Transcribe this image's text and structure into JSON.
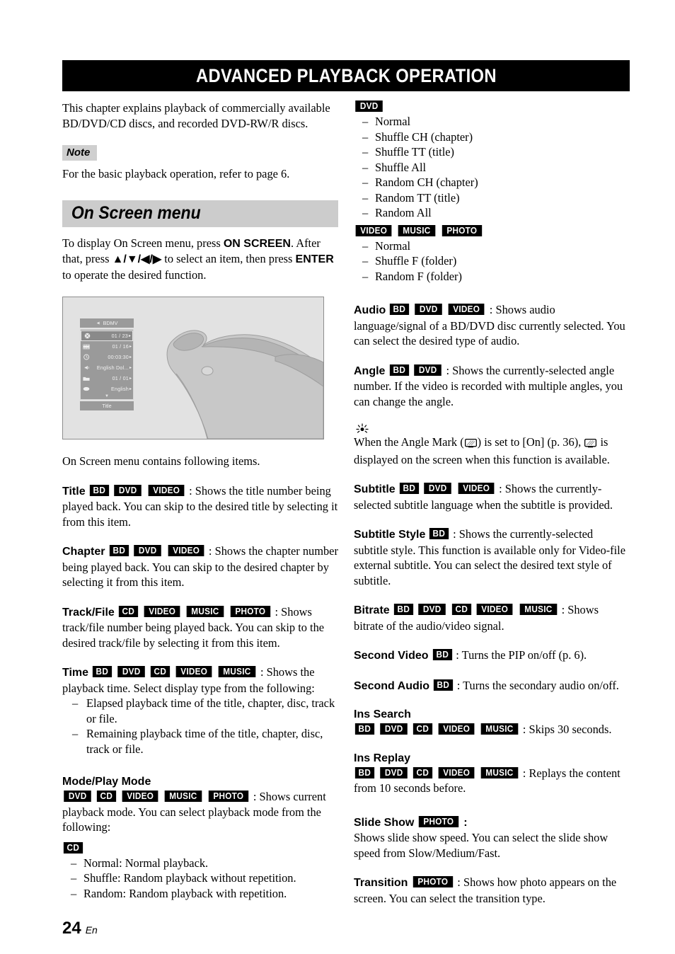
{
  "header": {
    "title": "ADVANCED PLAYBACK OPERATION"
  },
  "left_column": {
    "intro": "This chapter explains playback of commercially available BD/DVD/CD discs, and recorded DVD-RW/R discs.",
    "note_label": "Note",
    "note_text": "For the basic playback operation, refer to page 6.",
    "section_title": "On Screen menu",
    "section_intro_1": "To display On Screen menu, press ",
    "section_intro_key_1": "ON SCREEN",
    "section_intro_2": ". After that, press ",
    "section_intro_arrows": "▲/▼/◀/▶",
    "section_intro_3": " to select an item, then press ",
    "section_intro_key_2": "ENTER",
    "section_intro_4": " to operate the desired function.",
    "mockup": {
      "header_label": "BDMV",
      "footer_label": "Title",
      "rows": [
        {
          "icon": "disc-icon",
          "value": "01 / 23",
          "selected": true
        },
        {
          "icon": "filmstrip-icon",
          "value": "01 / 16",
          "selected": false
        },
        {
          "icon": "clock-icon",
          "value": "00:03:30",
          "selected": false
        },
        {
          "icon": "speaker-icon",
          "value": "English Dol...",
          "selected": false
        },
        {
          "icon": "folder-icon",
          "value": "01 / 01",
          "selected": false
        },
        {
          "icon": "subtitle-icon",
          "value": "English",
          "selected": false
        }
      ]
    },
    "contains_line": "On Screen menu contains following items.",
    "items": [
      {
        "term": "Title",
        "badges": [
          "BD",
          "DVD",
          "VIDEO"
        ],
        "body": ": Shows the title number being played back. You can skip to the desired title by selecting it from this item."
      },
      {
        "term": "Chapter",
        "badges": [
          "BD",
          "DVD",
          "VIDEO"
        ],
        "body": ": Shows the chapter number being played back. You can skip to the desired chapter by selecting it from this item."
      },
      {
        "term": "Track/File",
        "badges": [
          "CD",
          "VIDEO",
          "MUSIC",
          "PHOTO"
        ],
        "body": ": Shows track/file number being played back. You can skip to the desired track/file by selecting it from this item."
      },
      {
        "term": "Time",
        "badges": [
          "BD",
          "DVD",
          "CD",
          "VIDEO",
          "MUSIC"
        ],
        "body": ": Shows the playback time. Select display type from the following:",
        "list": [
          "Elapsed playback time of the title, chapter, disc, track or file.",
          "Remaining playback time of the title, chapter, disc, track or file."
        ]
      }
    ],
    "mode_item": {
      "term": "Mode/Play Mode",
      "badges": [
        "DVD",
        "CD",
        "VIDEO",
        "MUSIC",
        "PHOTO"
      ],
      "body": ": Shows current playback mode. You can select playback mode from the following:",
      "cd_badge": "CD",
      "cd_list": [
        "Normal: Normal playback.",
        "Shuffle: Random playback without repetition.",
        "Random: Random playback with repetition."
      ]
    }
  },
  "right_column": {
    "dvd_badge": "DVD",
    "dvd_list": [
      "Normal",
      "Shuffle CH (chapter)",
      "Shuffle TT (title)",
      "Shuffle All",
      "Random CH (chapter)",
      "Random TT (title)",
      "Random All"
    ],
    "vmp_badges": [
      "VIDEO",
      "MUSIC",
      "PHOTO"
    ],
    "vmp_list": [
      "Normal",
      "Shuffle F (folder)",
      "Random F (folder)"
    ],
    "items": [
      {
        "term": "Audio",
        "badges": [
          "BD",
          "DVD",
          "VIDEO"
        ],
        "body": ": Shows audio language/signal of a BD/DVD disc currently selected. You can select the desired type of audio."
      },
      {
        "term": "Angle",
        "badges": [
          "BD",
          "DVD"
        ],
        "body": ": Shows the currently-selected angle number. If the video is recorded with multiple angles, you can change the angle."
      }
    ],
    "tip": {
      "text_1": "When the Angle Mark (",
      "text_2": ") is set to [On] (p. 36), ",
      "text_3": " is displayed on the screen when this function is available."
    },
    "items2": [
      {
        "term": "Subtitle",
        "badges": [
          "BD",
          "DVD",
          "VIDEO"
        ],
        "body": ": Shows the currently-selected subtitle language when the subtitle is provided."
      },
      {
        "term": "Subtitle Style",
        "badges": [
          "BD"
        ],
        "body": ": Shows the currently-selected subtitle style. This function is available only for Video-file external subtitle. You can select the desired text style of subtitle."
      },
      {
        "term": "Bitrate",
        "badges": [
          "BD",
          "DVD",
          "CD",
          "VIDEO",
          "MUSIC"
        ],
        "body": ": Shows bitrate of the audio/video signal."
      },
      {
        "term": "Second Video",
        "badges": [
          "BD"
        ],
        "body": ": Turns the PIP on/off (p. 6)."
      },
      {
        "term": "Second Audio",
        "badges": [
          "BD"
        ],
        "body": ": Turns the secondary audio on/off."
      }
    ],
    "ins_search": {
      "term": "Ins Search",
      "badges": [
        "BD",
        "DVD",
        "CD",
        "VIDEO",
        "MUSIC"
      ],
      "body": ": Skips 30 seconds."
    },
    "ins_replay": {
      "term": "Ins Replay",
      "badges": [
        "BD",
        "DVD",
        "CD",
        "VIDEO",
        "MUSIC"
      ],
      "body": ": Replays the content from 10 seconds before."
    },
    "slide_show": {
      "term": "Slide Show",
      "badges": [
        "PHOTO"
      ],
      "colon": ":",
      "body": "Shows slide show speed. You can select the slide show speed from Slow/Medium/Fast."
    },
    "transition": {
      "term": "Transition",
      "badges": [
        "PHOTO"
      ],
      "body": ": Shows how photo appears on the screen. You can select the transition type."
    }
  },
  "footer": {
    "page_number": "24",
    "language": "En"
  },
  "colors": {
    "banner_bg": "#000000",
    "banner_text": "#ffffff",
    "band_bg": "#cccccc",
    "note_bg": "#cfcfcf",
    "badge_bg": "#000000",
    "badge_text": "#ffffff",
    "mockup_bg": "#e2e2e2",
    "osd_panel": "#9a9a9a"
  }
}
